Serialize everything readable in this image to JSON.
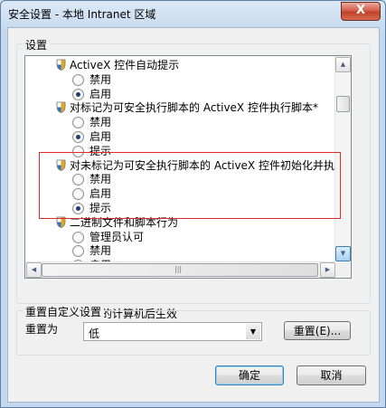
{
  "window": {
    "title": "安全设置 - 本地 Intranet 区域",
    "close_label": "X"
  },
  "settings_group": {
    "label": "设置"
  },
  "settings_list": [
    {
      "type": "header",
      "text": "ActiveX 控件自动提示"
    },
    {
      "type": "option",
      "text": "禁用",
      "checked": false
    },
    {
      "type": "option",
      "text": "启用",
      "checked": true
    },
    {
      "type": "header",
      "text": "对标记为可安全执行脚本的 ActiveX 控件执行脚本*"
    },
    {
      "type": "option",
      "text": "禁用",
      "checked": false
    },
    {
      "type": "option",
      "text": "启用",
      "checked": true
    },
    {
      "type": "option",
      "text": "提示",
      "checked": false
    },
    {
      "type": "header",
      "text": "对未标记为可安全执行脚本的 ActiveX 控件初始化并执"
    },
    {
      "type": "option",
      "text": "禁用",
      "checked": false
    },
    {
      "type": "option",
      "text": "启用",
      "checked": false
    },
    {
      "type": "option",
      "text": "提示",
      "checked": true
    },
    {
      "type": "header",
      "text": "二进制文件和脚本行为"
    },
    {
      "type": "option",
      "text": "管理员认可",
      "checked": false
    },
    {
      "type": "option",
      "text": "禁用",
      "checked": false
    },
    {
      "type": "option",
      "text": "启用",
      "checked": false
    }
  ],
  "note": "*在重新启动你的计算机后生效",
  "reset_group": {
    "label": "重置自定义设置",
    "reset_to_label": "重置为",
    "select_value": "低",
    "reset_button": "重置(E)..."
  },
  "buttons": {
    "ok": "确定",
    "cancel": "取消"
  },
  "colors": {
    "highlight_border": "#e02a2a",
    "title_bar": "#c3d7ee",
    "close_button": "#c2412b"
  },
  "icons": {
    "setting_icon": "shield-icon",
    "scroll_up": "up-arrow-icon",
    "scroll_down": "down-arrow-icon"
  }
}
